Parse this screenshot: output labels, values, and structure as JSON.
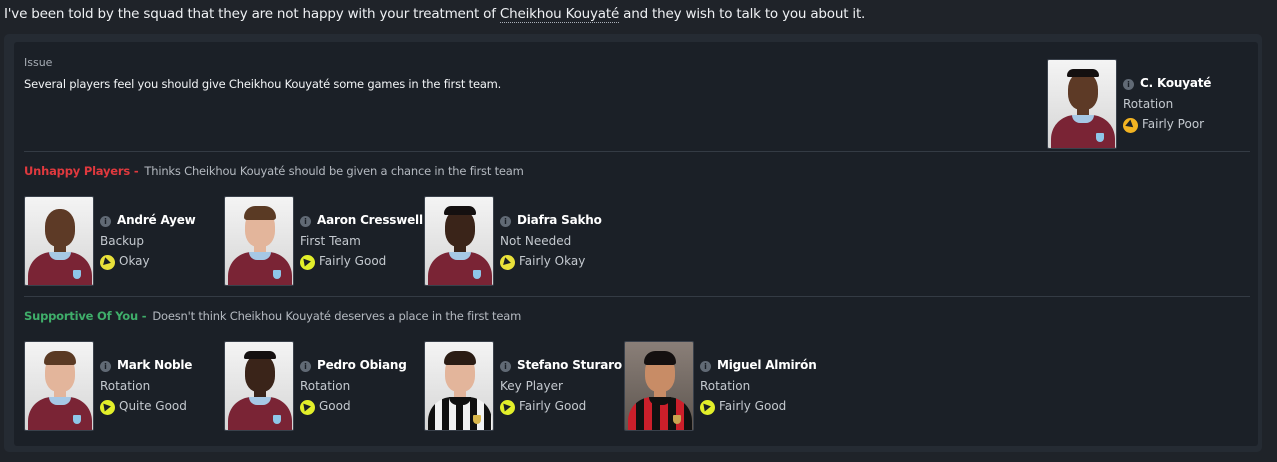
{
  "headline": {
    "before": "I've been told by the squad that they are not happy with your treatment of",
    "player": "Cheikhou Kouyaté",
    "after": "and they wish to talk to you about it."
  },
  "issue": {
    "label": "Issue",
    "text": "Several players feel you should give Cheikhou Kouyaté some games in the first team."
  },
  "subject": {
    "name": "C. Kouyaté",
    "role": "Rotation",
    "happiness": "Fairly Poor"
  },
  "unhappy": {
    "tag": "Unhappy Players -",
    "desc": "Thinks Cheikhou Kouyaté should be given a chance in the first team",
    "players": [
      {
        "name": "André Ayew",
        "role": "Backup",
        "happiness": "Okay"
      },
      {
        "name": "Aaron Cresswell",
        "role": "First Team",
        "happiness": "Fairly Good"
      },
      {
        "name": "Diafra Sakho",
        "role": "Not Needed",
        "happiness": "Fairly Okay"
      }
    ]
  },
  "supportive": {
    "tag": "Supportive Of You -",
    "desc": "Doesn't think Cheikhou Kouyaté deserves a place in the first team",
    "players": [
      {
        "name": "Mark Noble",
        "role": "Rotation",
        "happiness": "Quite Good"
      },
      {
        "name": "Pedro Obiang",
        "role": "Rotation",
        "happiness": "Good"
      },
      {
        "name": "Stefano Sturaro",
        "role": "Key Player",
        "happiness": "Fairly Good"
      },
      {
        "name": "Miguel Almirón",
        "role": "Rotation",
        "happiness": "Fairly Good"
      }
    ]
  },
  "icons": {
    "info": "info-icon",
    "happiness": "happiness-arrow-icon"
  },
  "colors": {
    "unhappy": "#e0393e",
    "supportive": "#3fae6a",
    "background": "#1f2329"
  }
}
